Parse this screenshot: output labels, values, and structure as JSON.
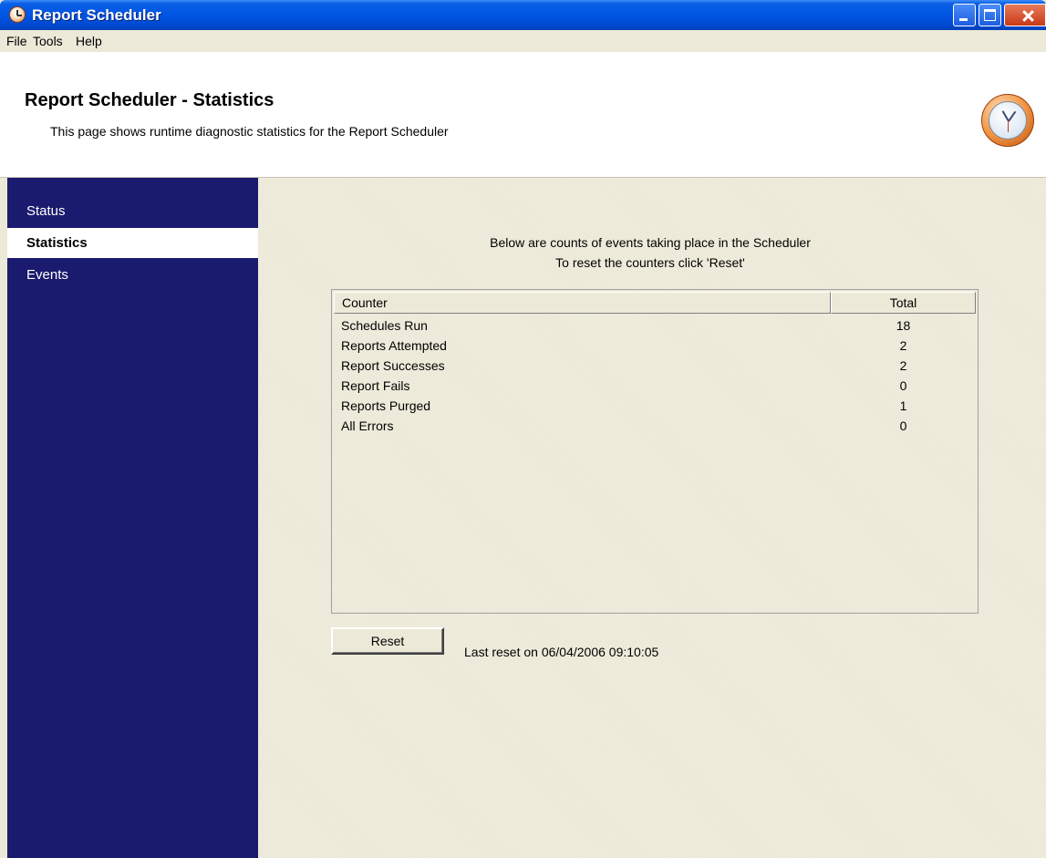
{
  "window": {
    "title": "Report Scheduler"
  },
  "menu": {
    "items": [
      "File",
      "Tools",
      "Help"
    ]
  },
  "header": {
    "title": "Report Scheduler - Statistics",
    "subtitle": "This page shows runtime diagnostic statistics for the Report Scheduler",
    "icon": "clock-icon"
  },
  "sidebar": {
    "items": [
      {
        "label": "Status",
        "active": false
      },
      {
        "label": "Statistics",
        "active": true
      },
      {
        "label": "Events",
        "active": false
      }
    ],
    "color": "#1a1a6e"
  },
  "main": {
    "intro_line1": "Below are counts of events taking place in the Scheduler",
    "intro_line2": "To reset the counters click 'Reset'",
    "table": {
      "columns": [
        "Counter",
        "Total"
      ],
      "rows": [
        {
          "counter": "Schedules Run",
          "total": "18"
        },
        {
          "counter": "Reports Attempted",
          "total": "2"
        },
        {
          "counter": "Report Successes",
          "total": "2"
        },
        {
          "counter": "Report Fails",
          "total": "0"
        },
        {
          "counter": "Reports Purged",
          "total": "1"
        },
        {
          "counter": "All Errors",
          "total": "0"
        }
      ]
    },
    "reset_label": "Reset",
    "last_reset_text": "Last reset on 06/04/2006 09:10:05"
  }
}
